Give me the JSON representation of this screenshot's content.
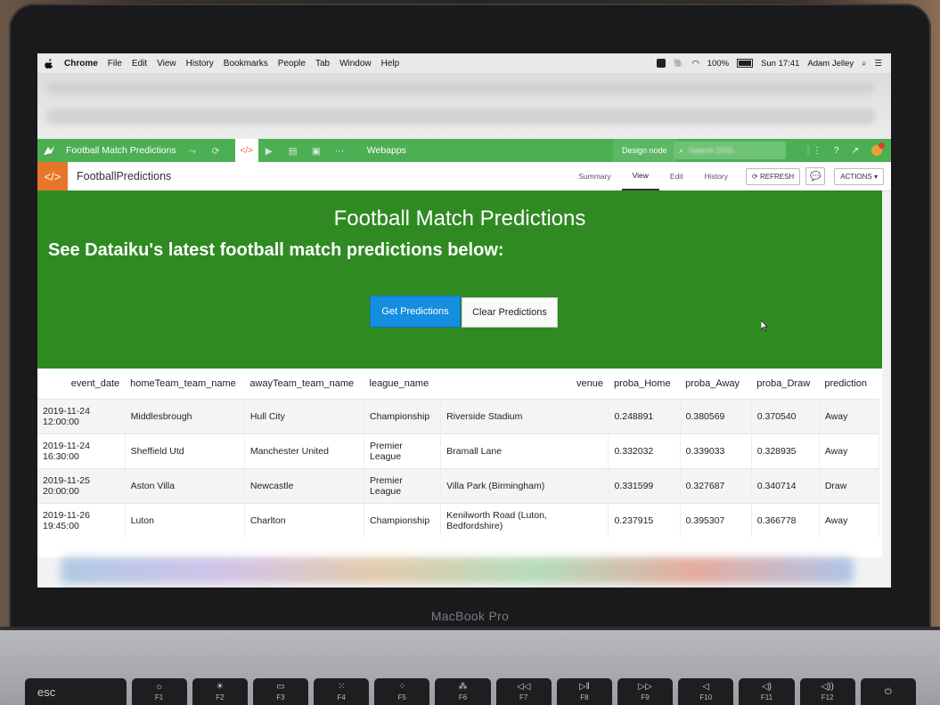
{
  "menubar": {
    "app": "Chrome",
    "items": [
      "File",
      "Edit",
      "View",
      "History",
      "Bookmarks",
      "People",
      "Tab",
      "Window",
      "Help"
    ],
    "battery": "100%",
    "clock": "Sun 17:41",
    "user": "Adam Jelley"
  },
  "dss_nav": {
    "project": "Football Match Predictions",
    "section": "Webapps",
    "node": "Design node",
    "search_placeholder": "Search DSS..."
  },
  "sub_header": {
    "title": "FootballPredictions",
    "tabs": [
      "Summary",
      "View",
      "Edit",
      "History"
    ],
    "active_tab": "View",
    "refresh_label": "REFRESH",
    "actions_label": "ACTIONS"
  },
  "hero": {
    "title": "Football Match Predictions",
    "subtitle": "See Dataiku's latest football match predictions below:",
    "get_button": "Get Predictions",
    "clear_button": "Clear Predictions",
    "accent_color": "#2f8a22",
    "button_color": "#168ee0"
  },
  "table": {
    "headers": [
      "event_date",
      "homeTeam_team_name",
      "awayTeam_team_name",
      "league_name",
      "venue",
      "proba_Home",
      "proba_Away",
      "proba_Draw",
      "prediction"
    ],
    "rows": [
      [
        "2019-11-24 12:00:00",
        "Middlesbrough",
        "Hull City",
        "Championship",
        "Riverside Stadium",
        "0.248891",
        "0.380569",
        "0.370540",
        "Away"
      ],
      [
        "2019-11-24 16:30:00",
        "Sheffield Utd",
        "Manchester United",
        "Premier League",
        "Bramall Lane",
        "0.332032",
        "0.339033",
        "0.328935",
        "Away"
      ],
      [
        "2019-11-25 20:00:00",
        "Aston Villa",
        "Newcastle",
        "Premier League",
        "Villa Park (Birmingham)",
        "0.331599",
        "0.327687",
        "0.340714",
        "Draw"
      ],
      [
        "2019-11-26 19:45:00",
        "Luton",
        "Charlton",
        "Championship",
        "Kenilworth Road (Luton, Bedfordshire)",
        "0.237915",
        "0.395307",
        "0.366778",
        "Away"
      ]
    ]
  },
  "laptop": {
    "model": "MacBook Pro",
    "keys": [
      "esc",
      "F1",
      "F2",
      "F3",
      "F4",
      "F5",
      "F6",
      "F7",
      "F8",
      "F9",
      "F10",
      "F11",
      "F12"
    ]
  }
}
